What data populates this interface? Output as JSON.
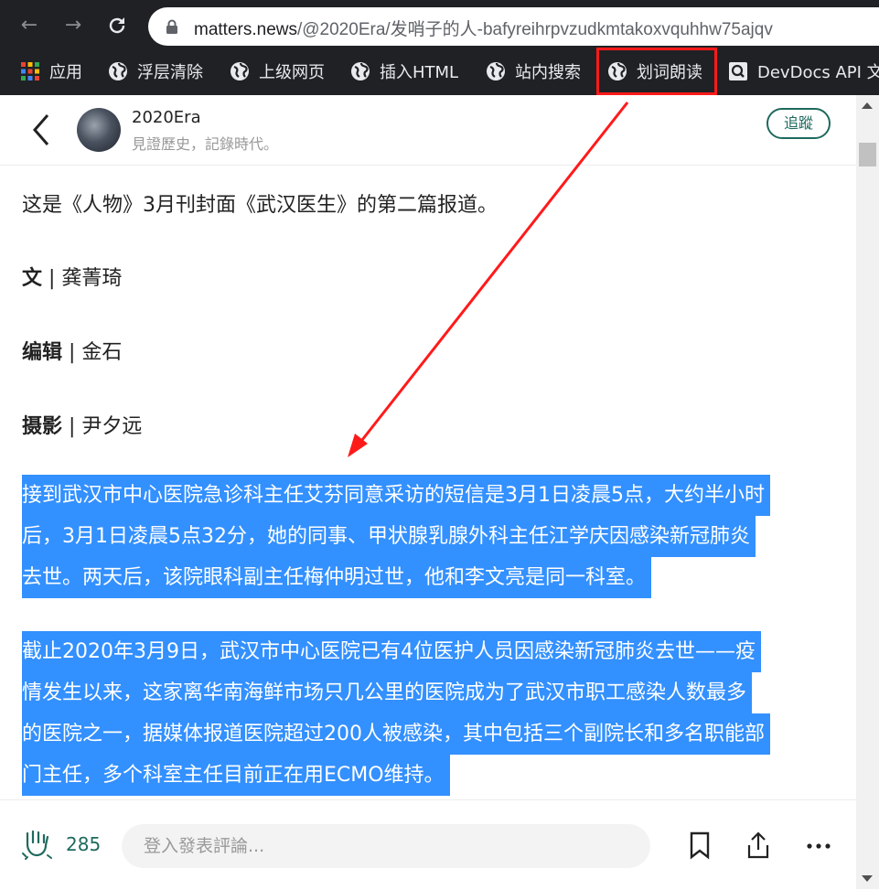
{
  "browser": {
    "url_host": "matters.news",
    "url_path": "/@2020Era/发哨子的人-bafyreihrpvzudkmtakoxvquhhw75ajqv",
    "bookmarks": [
      {
        "label": "应用",
        "icon": "apps-grid-icon"
      },
      {
        "label": "浮层清除",
        "icon": "globe-icon"
      },
      {
        "label": "上级网页",
        "icon": "globe-icon"
      },
      {
        "label": "插入HTML",
        "icon": "globe-icon"
      },
      {
        "label": "站内搜索",
        "icon": "globe-icon"
      },
      {
        "label": "划词朗读",
        "icon": "globe-icon"
      },
      {
        "label": "DevDocs API 文",
        "icon": "search-icon"
      }
    ]
  },
  "header": {
    "author": "2020Era",
    "bio": "見證歷史，記錄時代。",
    "follow_label": "追蹤"
  },
  "article": {
    "intro": "这是《人物》3月刊封面《武汉医生》的第二篇报道。",
    "credits": [
      {
        "role": "文",
        "name": "龚菁琦"
      },
      {
        "role": "编辑",
        "name": "金石"
      },
      {
        "role": "摄影",
        "name": "尹夕远"
      }
    ],
    "credit_sep": " | ",
    "para1": [
      "接到武汉市中心医院急诊科主任艾芬同意采访的短信是3月1日凌晨5点，大约半小时",
      "后，3月1日凌晨5点32分，她的同事、甲状腺乳腺外科主任江学庆因感染新冠肺炎",
      "去世。两天后，该院眼科副主任梅仲明过世，他和李文亮是同一科室。"
    ],
    "para2": [
      "截止2020年3月9日，武汉市中心医院已有4位医护人员因感染新冠肺炎去世——疫",
      "情发生以来，这家离华南海鲜市场只几公里的医院成为了武汉市职工感染人数最多",
      "的医院之一，据媒体报道医院超过200人被感染，其中包括三个副院长和多名职能部",
      "门主任，多个科室主任目前正在用ECMO维持。"
    ]
  },
  "footer": {
    "clap_count": "285",
    "comment_placeholder": "登入發表評論..."
  },
  "colors": {
    "selection": "#3390ff",
    "accent": "#1e6a5e",
    "annotation_red": "#ff1a1a"
  }
}
